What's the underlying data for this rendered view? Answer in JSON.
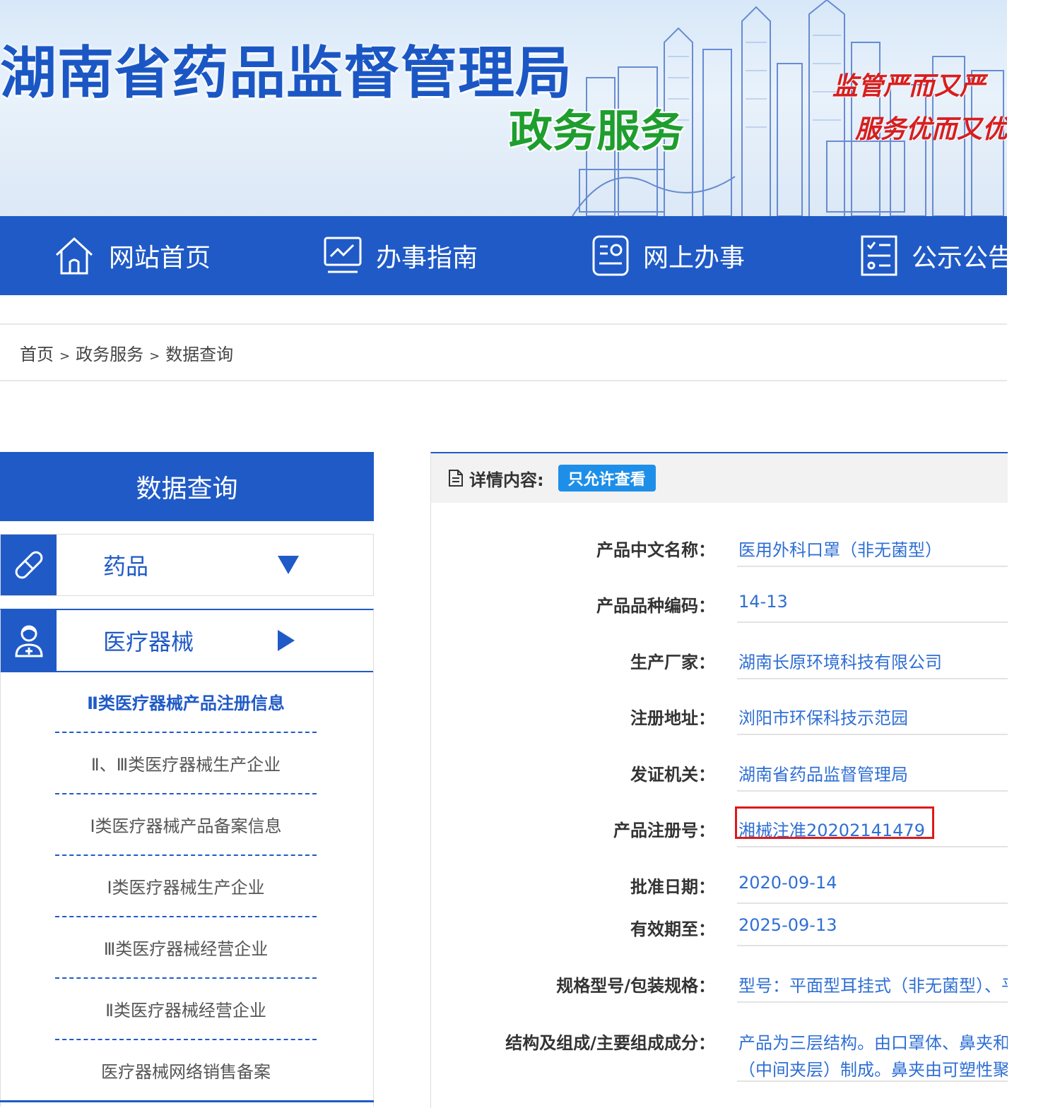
{
  "banner": {
    "title": "湖南省药品监督管理局",
    "subtitle": "政务服务",
    "slogan_line1": "监管严而又严",
    "slogan_line2": "服务优而又优"
  },
  "nav": {
    "items": [
      {
        "label": "网站首页",
        "icon": "home-icon"
      },
      {
        "label": "办事指南",
        "icon": "guide-icon"
      },
      {
        "label": "网上办事",
        "icon": "online-service-icon"
      },
      {
        "label": "公示公告",
        "icon": "notice-icon"
      }
    ]
  },
  "breadcrumb": {
    "items": [
      "首页",
      "政务服务",
      "数据查询"
    ],
    "separator": ">"
  },
  "sidebar": {
    "title": "数据查询",
    "categories": [
      {
        "label": "药品",
        "icon": "pill-icon",
        "arrow": "triangle-down-icon"
      },
      {
        "label": "医疗器械",
        "icon": "doctor-icon",
        "arrow": "triangle-right-icon"
      }
    ],
    "sub_items": [
      "Ⅱ类医疗器械产品注册信息",
      "Ⅱ、Ⅲ类医疗器械生产企业",
      "Ⅰ类医疗器械产品备案信息",
      "Ⅰ类医疗器械生产企业",
      "Ⅲ类医疗器械经营企业",
      "Ⅱ类医疗器械经营企业",
      "医疗器械网络销售备案"
    ],
    "active_index": 0
  },
  "detail": {
    "header": "详情内容:",
    "badge": "只允许查看",
    "fields": [
      {
        "key": "产品中文名称：",
        "value": "医用外科口罩（非无菌型）"
      },
      {
        "key": "产品品种编码：",
        "value": "14-13"
      },
      {
        "key": "生产厂家：",
        "value": "湖南长原环境科技有限公司"
      },
      {
        "key": "注册地址：",
        "value": "浏阳市环保科技示范园"
      },
      {
        "key": "发证机关：",
        "value": "湖南省药品监督管理局"
      },
      {
        "key": "产品注册号：",
        "value": "湘械注准20202141479"
      },
      {
        "key": "批准日期：",
        "value": "2020-09-14"
      },
      {
        "key": "有效期至：",
        "value": "2025-09-13"
      },
      {
        "key": "规格型号/包装规格：",
        "value": "型号：平面型耳挂式（非无菌型）、平"
      },
      {
        "key": "结构及组成/主要组成成分：",
        "value": "产品为三层结构。由口罩体、鼻夹和口",
        "value2": "（中间夹层）制成。鼻夹由可塑性聚丙"
      }
    ]
  },
  "colors": {
    "primary": "#1f5ac7",
    "banner_title": "#1b57c4",
    "banner_subtitle": "#1e9e2e",
    "slogan": "#d81e1e",
    "badge": "#1e8fe8",
    "value_text": "#2f6fd4",
    "highlight_box": "#e01919"
  }
}
